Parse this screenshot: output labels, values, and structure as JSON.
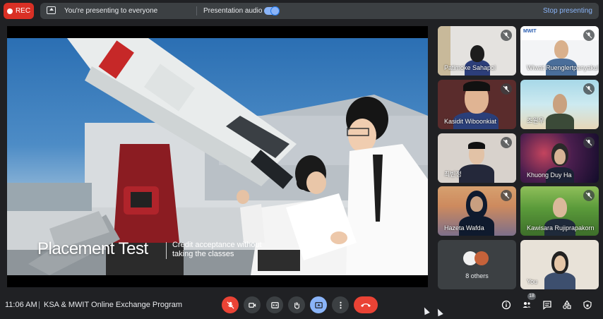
{
  "topbar": {
    "rec_label": "REC",
    "presenting_text": "You're presenting to everyone",
    "audio_label": "Presentation audio",
    "audio_on": true,
    "stop_label": "Stop presenting"
  },
  "slide": {
    "title": "Placement Test",
    "subtitle": "Credit acceptance without taking the classes"
  },
  "participants": [
    {
      "name": "Patimoke Sahapol",
      "muted": true
    },
    {
      "name": "Wiwat Ruenglertpanyakul",
      "muted": true
    },
    {
      "name": "Kasidit Wiboonkiat",
      "muted": true
    },
    {
      "name": "조원우",
      "muted": true
    },
    {
      "name": "최빈정",
      "muted": true
    },
    {
      "name": "Khuong Duy Ha",
      "muted": true
    },
    {
      "name": "Hazeta Wafda",
      "muted": true
    },
    {
      "name": "Kawisara Rujiprapakorn",
      "muted": true
    },
    {
      "name": "8 others",
      "muted": false
    },
    {
      "name": "You",
      "muted": false
    }
  ],
  "bottom": {
    "time": "11:06 AM",
    "separator": "|",
    "meeting_title": "KSA & MWIT Online Exchange Program",
    "people_count": "18"
  },
  "colors": {
    "background": "#202124",
    "control": "#3c4043",
    "danger": "#ea4335",
    "accent": "#8ab4f8"
  }
}
